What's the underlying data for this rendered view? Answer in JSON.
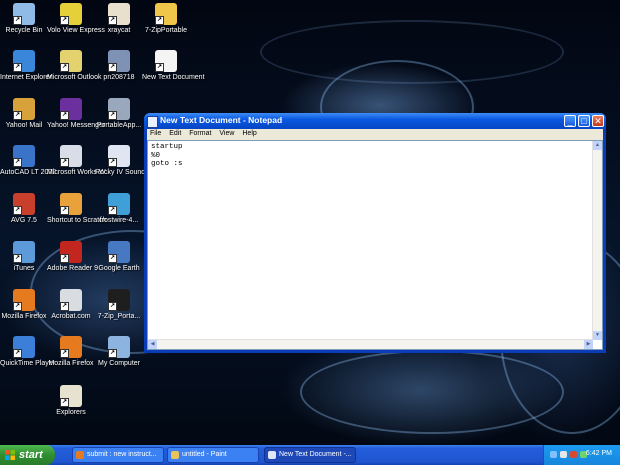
{
  "desktop": {
    "icons": [
      {
        "label": "Recycle Bin",
        "icon": "recycle-bin-icon",
        "color": "#8fbbe6"
      },
      {
        "label": "Volo View Express",
        "icon": "volo-view-icon",
        "color": "#e6d03a"
      },
      {
        "label": "xraycat",
        "icon": "xraycat-icon",
        "color": "#e8e0cc"
      },
      {
        "label": "7-ZipPortable",
        "icon": "folder-icon",
        "color": "#f0c64a"
      },
      {
        "label": "Internet Explorer",
        "icon": "internet-explorer-icon",
        "color": "#3a86d9"
      },
      {
        "label": "Microsoft Outlook",
        "icon": "outlook-icon",
        "color": "#e4d26e"
      },
      {
        "label": "pn208718",
        "icon": "pn-file-icon",
        "color": "#7d92b5"
      },
      {
        "label": "New Text Document",
        "icon": "text-document-icon",
        "color": "#f4f4f4"
      },
      {
        "label": "Yahoo! Mail",
        "icon": "yahoo-mail-icon",
        "color": "#d8a23a"
      },
      {
        "label": "Yahoo! Messenger",
        "icon": "yahoo-messenger-icon",
        "color": "#6b2f9e"
      },
      {
        "label": "PortableApp...",
        "icon": "portableapps-icon",
        "color": "#9aa8bd"
      },
      {
        "label": "AutoCAD LT 2002",
        "icon": "autocad-icon",
        "color": "#3a74c9"
      },
      {
        "label": "Microsoft Works W...",
        "icon": "works-icon",
        "color": "#d8dde8"
      },
      {
        "label": "Rocky IV Soundtrack ...",
        "icon": "media-file-icon",
        "color": "#dfe6f2"
      },
      {
        "label": "AVG 7.5",
        "icon": "avg-icon",
        "color": "#c8402b"
      },
      {
        "label": "Shortcut to Scratch",
        "icon": "scratch-icon",
        "color": "#e9a23a"
      },
      {
        "label": "frostwire-4...",
        "icon": "frostwire-icon",
        "color": "#3fa0d8"
      },
      {
        "label": "iTunes",
        "icon": "itunes-icon",
        "color": "#5d9ad9"
      },
      {
        "label": "Adobe Reader 9",
        "icon": "adobe-reader-icon",
        "color": "#c2261f"
      },
      {
        "label": "Google Earth",
        "icon": "google-earth-icon",
        "color": "#4778c2"
      },
      {
        "label": "Mozilla Firefox",
        "icon": "firefox-icon",
        "color": "#e67a1f"
      },
      {
        "label": "Acrobat.com",
        "icon": "acrobat-icon",
        "color": "#d9dde2"
      },
      {
        "label": "7-Zip_Porta...",
        "icon": "seven-zip-icon",
        "color": "#1e1e1e"
      },
      {
        "label": "QuickTime Player",
        "icon": "quicktime-icon",
        "color": "#3b7fd8"
      },
      {
        "label": "Mozilla Firefox",
        "icon": "firefox-icon",
        "color": "#e67a1f"
      },
      {
        "label": "My Computer",
        "icon": "my-computer-icon",
        "color": "#8db3e0"
      },
      {
        "label": "Explorers",
        "icon": "explorers-icon",
        "color": "#e7e2d0"
      }
    ]
  },
  "notepad": {
    "title": "New Text Document - Notepad",
    "menu": [
      "File",
      "Edit",
      "Format",
      "View",
      "Help"
    ],
    "content": "startup\n%0\ngoto :s"
  },
  "taskbar": {
    "start_label": "start",
    "tasks": [
      {
        "label": "submit : new instruct...",
        "icon": "firefox-icon",
        "color": "#e67a1f",
        "active": false
      },
      {
        "label": "untitled - Paint",
        "icon": "paint-icon",
        "color": "#e8c25a",
        "active": false
      },
      {
        "label": "New Text Document -...",
        "icon": "notepad-icon",
        "color": "#dfe8f8",
        "active": true
      }
    ],
    "tray_icons": [
      "network-icon",
      "volume-icon",
      "antivirus-icon",
      "messenger-icon"
    ],
    "clock": "6:42 PM"
  }
}
